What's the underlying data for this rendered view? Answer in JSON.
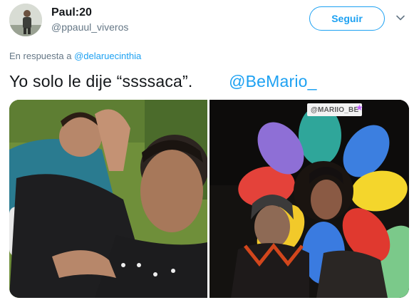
{
  "author": {
    "display_name": "Paul:20",
    "handle": "@ppauul_viveros",
    "follow_label": "Seguir"
  },
  "reply": {
    "prefix": "En respuesta a",
    "mention": "@delaruecinthia"
  },
  "tweet": {
    "text": "Yo solo le dije “ssssaca”.",
    "mention": "@BeMario_"
  },
  "media": {
    "right_photo_tag": "@MARIIO_BE",
    "tag_star": "★"
  },
  "colors": {
    "accent": "#1da1f2",
    "secondary_text": "#657786",
    "primary_text": "#14171a"
  }
}
